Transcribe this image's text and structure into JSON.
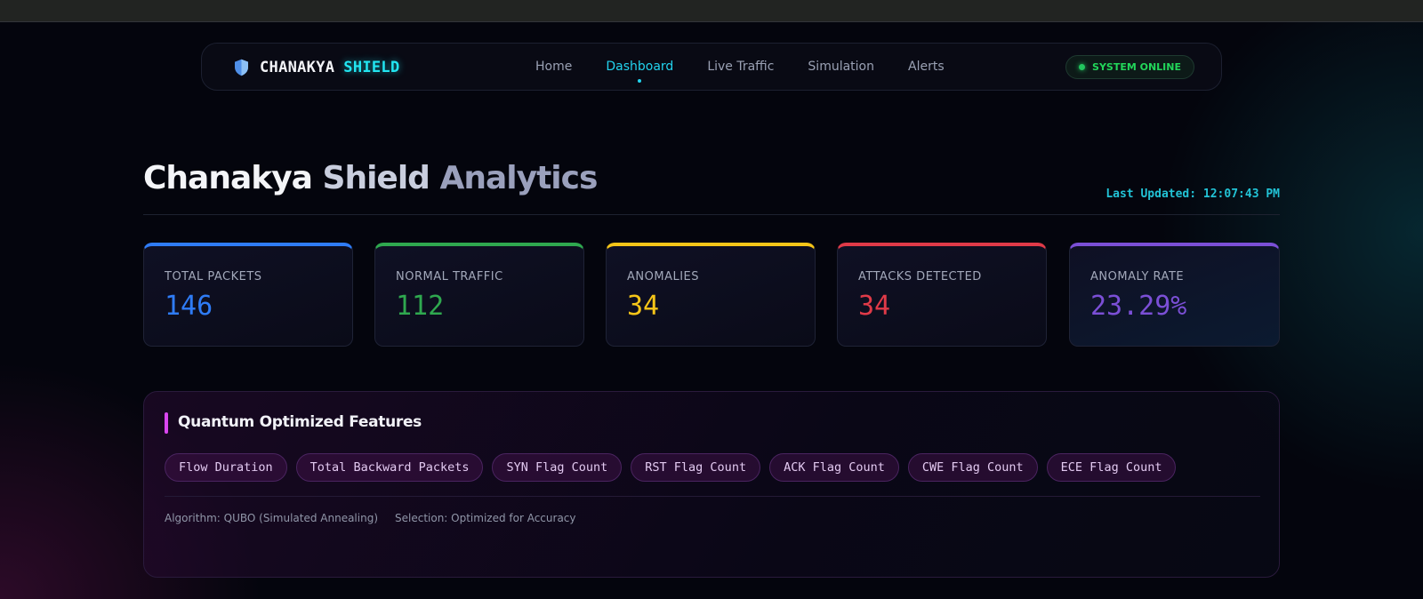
{
  "nav": {
    "brand_word1": "CHANAKYA",
    "brand_word2": "SHIELD",
    "links": [
      "Home",
      "Dashboard",
      "Live Traffic",
      "Simulation",
      "Alerts"
    ],
    "active_link": "Dashboard",
    "status": "SYSTEM ONLINE"
  },
  "header": {
    "title_part1": "Chanakya",
    "title_part2": "Shield",
    "title_part3": "Analytics",
    "last_updated": "Last Updated: 12:07:43 PM"
  },
  "stats": [
    {
      "label": "TOTAL PACKETS",
      "value": "146",
      "color": "#2f7cf6"
    },
    {
      "label": "NORMAL TRAFFIC",
      "value": "112",
      "color": "#2fa84f"
    },
    {
      "label": "ANOMALIES",
      "value": "34",
      "color": "#f5c518"
    },
    {
      "label": "ATTACKS DETECTED",
      "value": "34",
      "color": "#e03a48"
    },
    {
      "label": "ANOMALY RATE",
      "value": "23.29%",
      "color": "#7b4fd6"
    }
  ],
  "features": {
    "title": "Quantum Optimized Features",
    "chips": [
      "Flow Duration",
      "Total Backward Packets",
      "SYN Flag Count",
      "RST Flag Count",
      "ACK Flag Count",
      "CWE Flag Count",
      "ECE Flag Count"
    ],
    "algorithm": "Algorithm: QUBO (Simulated Annealing)",
    "selection": "Selection: Optimized for Accuracy"
  },
  "colors": {
    "accent_cyan": "#22d3ee",
    "online_green": "#22c55e",
    "feature_accent": "#d946ef"
  }
}
